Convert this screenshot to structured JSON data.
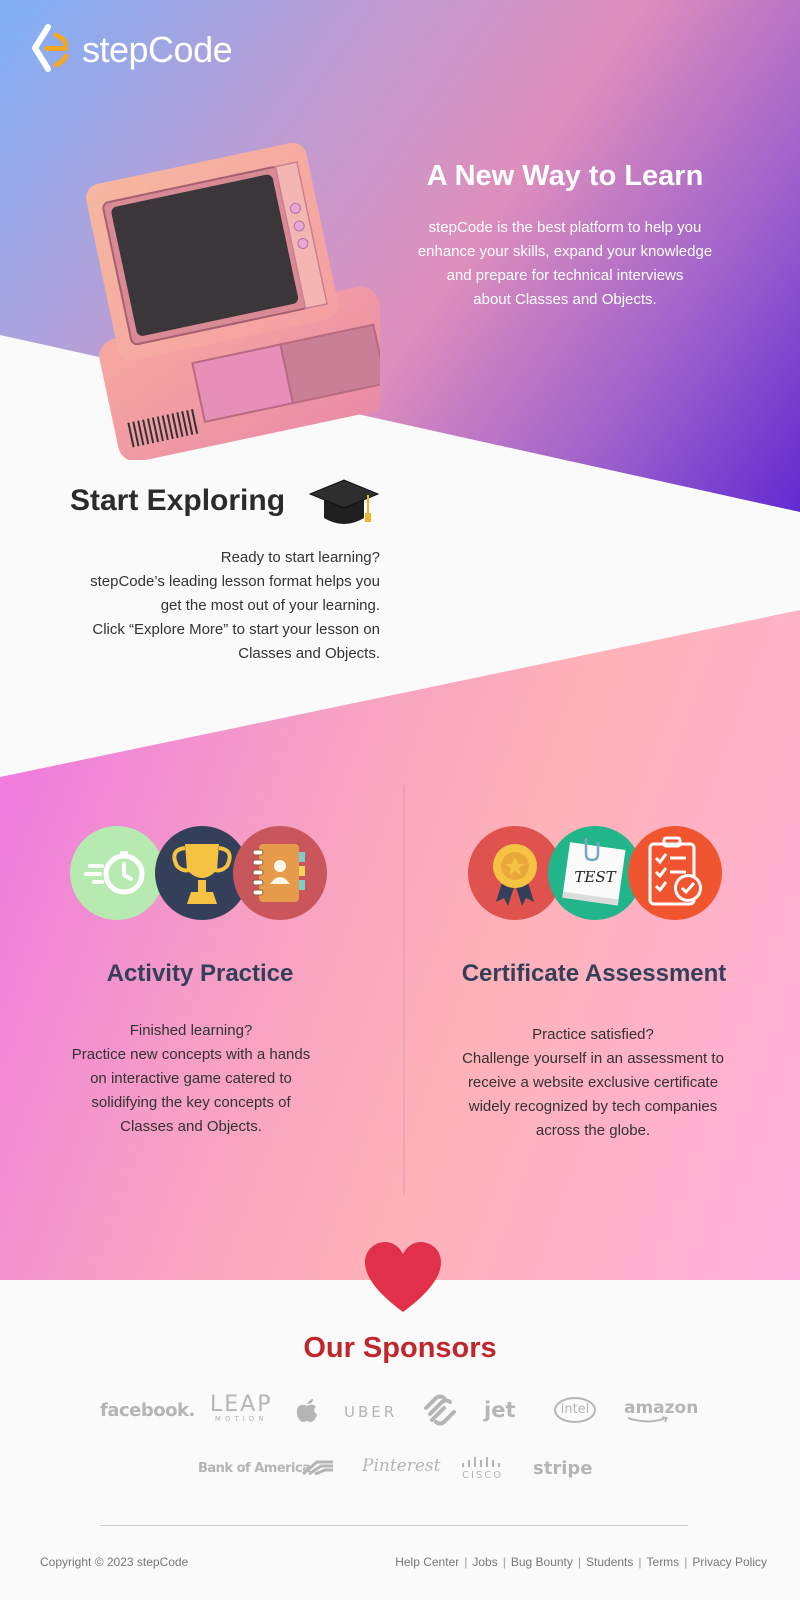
{
  "brand": {
    "name": "stepCode"
  },
  "hero": {
    "title": "A New Way to Learn",
    "line1": "stepCode is the best platform to help you",
    "line2": "enhance your skills, expand your knowledge",
    "line3": "and prepare for technical interviews",
    "line4": "about Classes and Objects."
  },
  "explore": {
    "title": "Start Exploring",
    "line1": "Ready to start learning?",
    "line2": "stepCode’s leading lesson format helps you",
    "line3": "get the most out of your learning.",
    "line4": "Click “Explore More” to start your lesson on",
    "line5": "Classes and Objects."
  },
  "practice": {
    "title": "Activity Practice",
    "line1": "Finished learning?",
    "line2": "Practice new concepts with a hands",
    "line3": "on interactive game catered to",
    "line4": "solidifying the key concepts of",
    "line5": "Classes and Objects."
  },
  "assessment": {
    "title": "Certificate Assessment",
    "badge_text": "TEST",
    "line1": "Practice satisfied?",
    "line2": "Challenge yourself in an assessment to",
    "line3": "receive a website exclusive certificate",
    "line4": "widely recognized by tech companies",
    "line5": "across the globe."
  },
  "sponsors": {
    "title": "Our Sponsors",
    "row1": [
      "facebook.",
      "LEAP",
      "UBER",
      "jet",
      "intel",
      "amazon"
    ],
    "leap_sub": "MOTION",
    "row2": [
      "Bank of America",
      "Pinterest",
      "CISCO",
      "stripe"
    ]
  },
  "footer": {
    "copyright": "Copyright © 2023 stepCode",
    "links": [
      "Help Center",
      "Jobs",
      "Bug Bounty",
      "Students",
      "Terms",
      "Privacy Policy"
    ]
  },
  "colors": {
    "accent_red": "#c0272d",
    "heading_navy": "#34405a",
    "logo_orange": "#f5a623"
  },
  "icons": [
    "stepcode-logo-icon",
    "retro-computer-illustration",
    "graduation-cap-icon",
    "stopwatch-icon",
    "trophy-icon",
    "contacts-book-icon",
    "award-medal-icon",
    "test-note-icon",
    "checklist-icon",
    "heart-icon",
    "apple-logo",
    "squarespace-logo"
  ]
}
